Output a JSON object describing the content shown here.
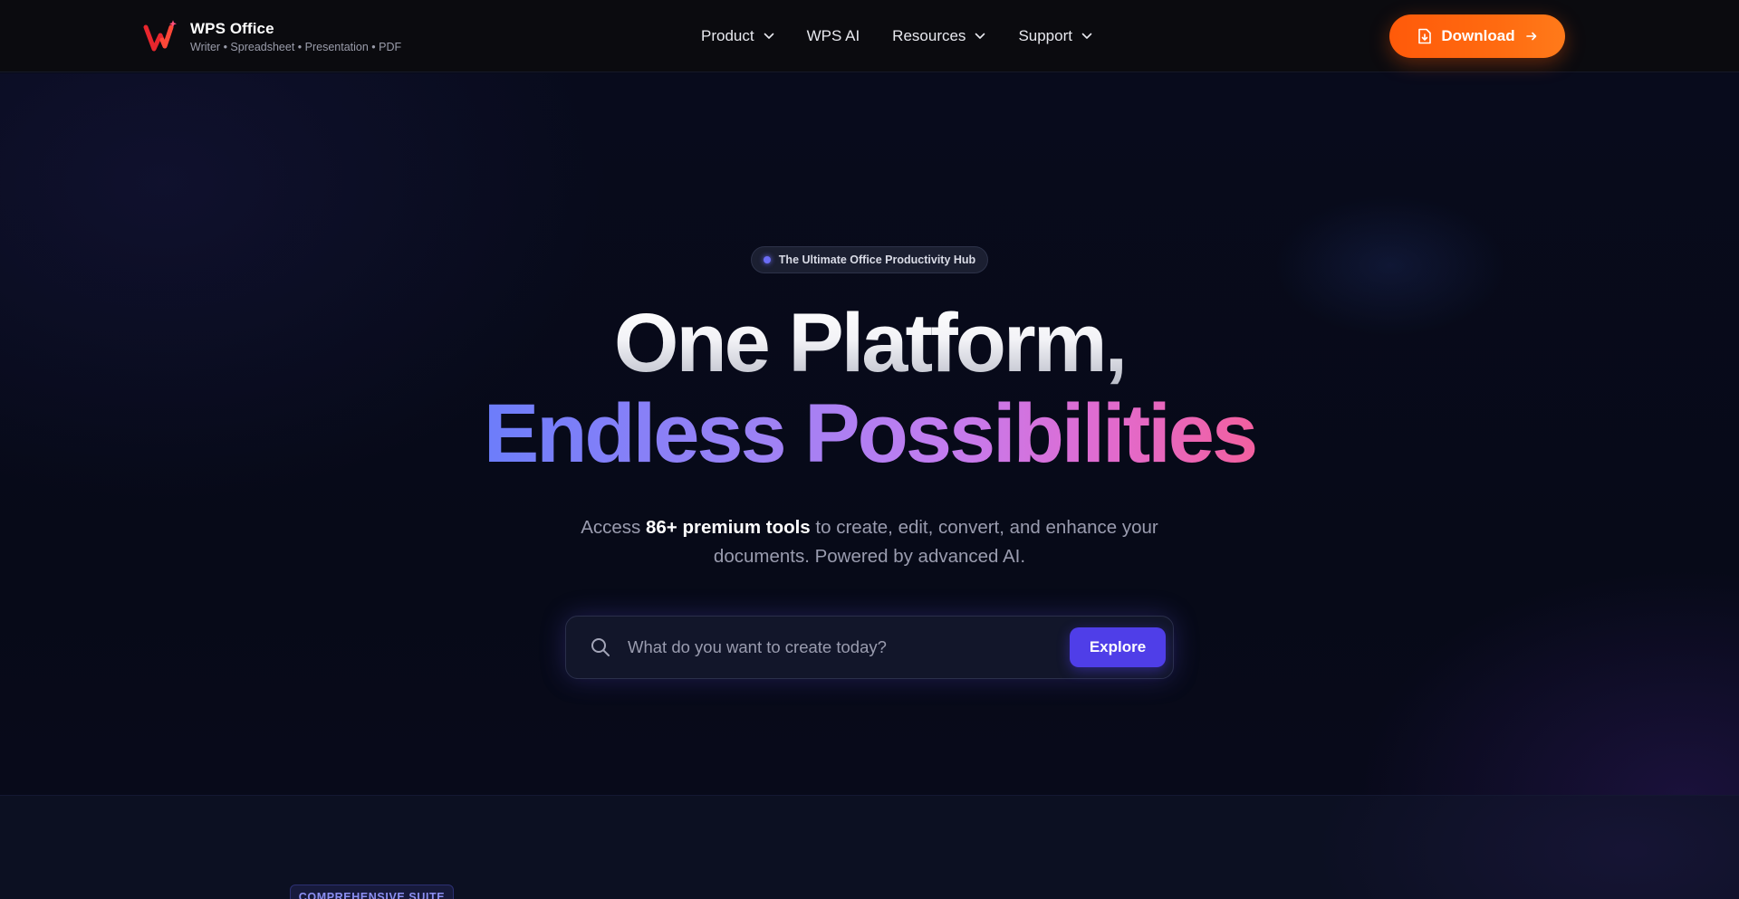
{
  "brand": {
    "name": "WPS Office",
    "tagline": "Writer • Spreadsheet • Presentation • PDF",
    "logo_icon": "wps-logo-icon"
  },
  "nav": {
    "items": [
      {
        "label": "Product",
        "has_dropdown": true
      },
      {
        "label": "WPS AI",
        "has_dropdown": false
      },
      {
        "label": "Resources",
        "has_dropdown": true
      },
      {
        "label": "Support",
        "has_dropdown": true
      }
    ],
    "download_label": "Download"
  },
  "hero": {
    "badge": "The Ultimate Office Productivity Hub",
    "title_line1": "One Platform,",
    "title_line2": "Endless Possibilities",
    "subtitle_pre": "Access ",
    "subtitle_bold": "86+ premium tools",
    "subtitle_post": " to create, edit, convert, and enhance your documents. Powered by advanced AI."
  },
  "search": {
    "placeholder": "What do you want to create today?",
    "button_label": "Explore"
  },
  "next_section": {
    "badge": "COMPREHENSIVE SUITE"
  },
  "colors": {
    "accent_orange": "#ff5a0a",
    "accent_indigo": "#4f3ee8",
    "gradient_start": "#6c7dfa",
    "gradient_end": "#f2609f",
    "background": "#070a18"
  }
}
